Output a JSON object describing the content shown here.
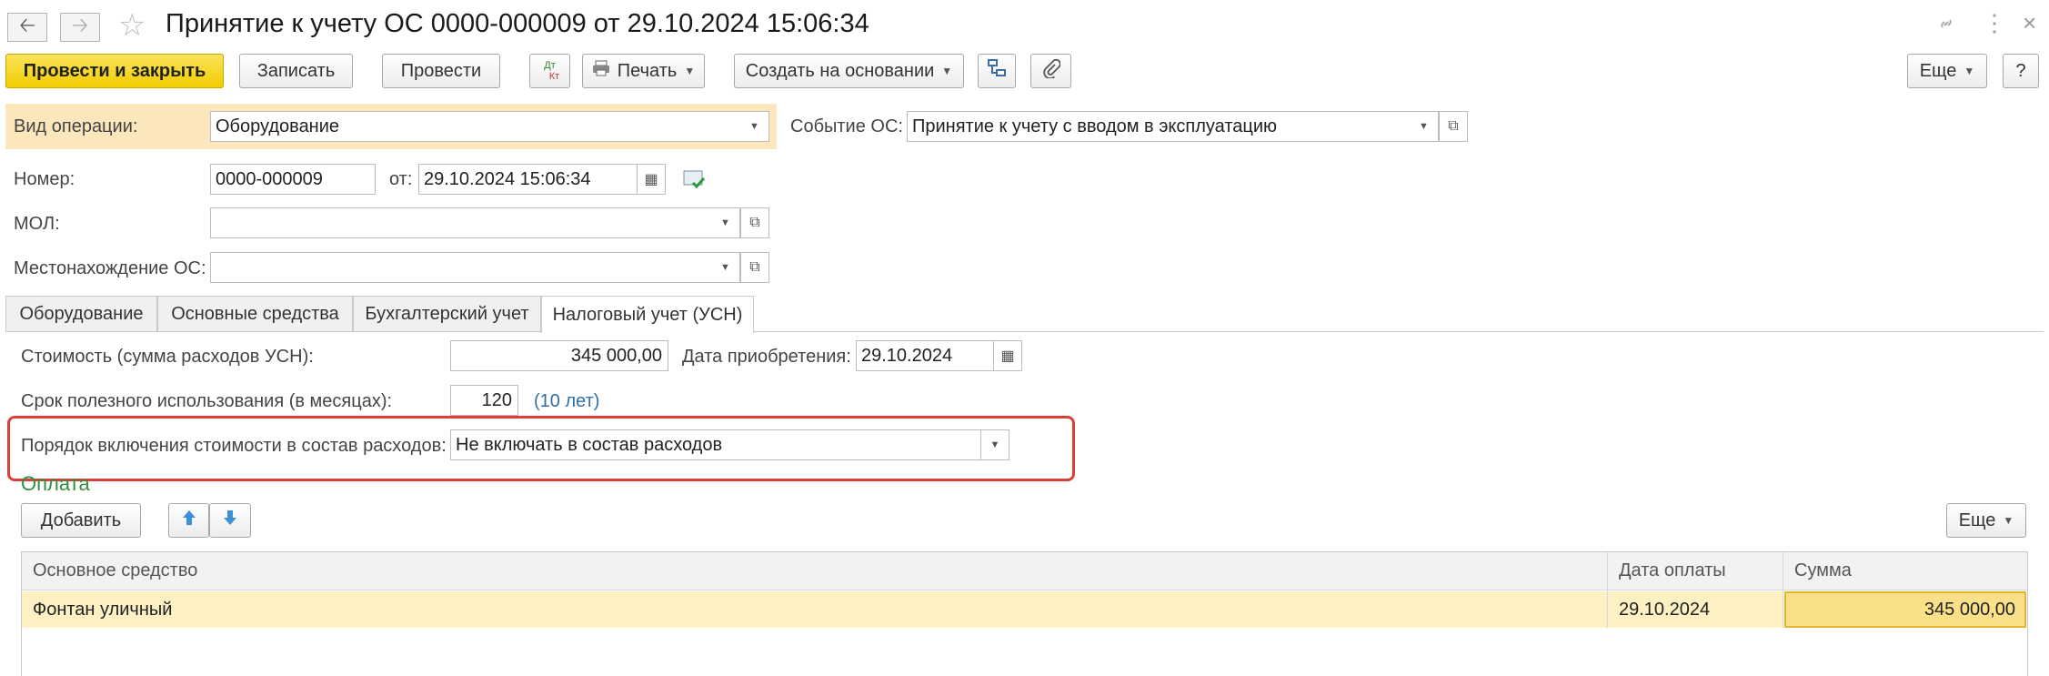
{
  "window": {
    "title": "Принятие к учету ОС 0000-000009 от 29.10.2024 15:06:34"
  },
  "toolbar": {
    "post_close": "Провести и закрыть",
    "save": "Записать",
    "post": "Провести",
    "dtkt_top": "Дт",
    "dtkt_bottom": "Кт",
    "print": "Печать",
    "create_based": "Создать на основании",
    "more": "Еще",
    "help": "?"
  },
  "form": {
    "op_type_label": "Вид операции:",
    "op_type_value": "Оборудование",
    "event_label": "Событие ОС:",
    "event_value": "Принятие к учету с вводом в эксплуатацию",
    "number_label": "Номер:",
    "number_value": "0000-000009",
    "date_label": "от:",
    "date_value": "29.10.2024 15:06:34",
    "mol_label": "МОЛ:",
    "mol_value": "",
    "location_label": "Местонахождение ОС:",
    "location_value": ""
  },
  "tabs": [
    {
      "label": "Оборудование"
    },
    {
      "label": "Основные средства"
    },
    {
      "label": "Бухгалтерский учет"
    },
    {
      "label": "Налоговый учет (УСН)"
    }
  ],
  "tax": {
    "cost_label": "Стоимость (сумма расходов УСН):",
    "cost_value": "345 000,00",
    "acq_date_label": "Дата приобретения:",
    "acq_date_value": "29.10.2024",
    "life_label": "Срок полезного использования (в месяцах):",
    "life_value": "120",
    "life_years": "(10 лет)",
    "order_label": "Порядок включения стоимости в состав расходов:",
    "order_value": "Не включать в состав расходов"
  },
  "payment": {
    "title": "Оплата",
    "add": "Добавить",
    "more": "Еще",
    "columns": [
      "Основное средство",
      "Дата оплаты",
      "Сумма"
    ],
    "rows": [
      {
        "asset": "Фонтан уличный",
        "date": "29.10.2024",
        "sum": "345 000,00"
      }
    ]
  },
  "colors": {
    "primary_button": "#f1cd00",
    "operation_band": "#fce7bd",
    "highlight_border": "#d9403a",
    "section_title": "#2f8f3e",
    "selected_row": "#fdf0c2",
    "active_cell": "#fbe08a"
  },
  "icons": [
    "back-arrow-icon",
    "forward-arrow-icon",
    "star-icon",
    "link-icon",
    "kebab-icon",
    "close-icon",
    "printer-icon",
    "structure-icon",
    "paperclip-icon",
    "calendar-icon",
    "status-check-icon",
    "arrow-up-icon",
    "arrow-down-icon",
    "open-icon"
  ]
}
